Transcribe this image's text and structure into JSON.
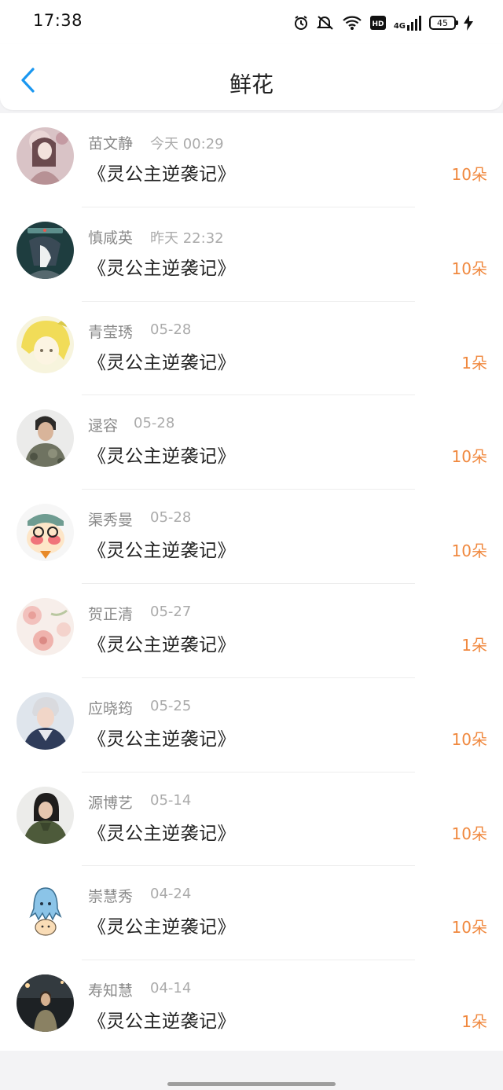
{
  "status_bar": {
    "time": "17:38",
    "network": "4G",
    "hd": "HD",
    "battery": "45"
  },
  "header": {
    "title": "鲜花"
  },
  "colors": {
    "accent": "#1a97f0",
    "count": "#f0883e",
    "name": "#8a8a8a",
    "time": "#ababab"
  },
  "entries": [
    {
      "name": "苗文静",
      "time": "今天 00:29",
      "book": "《灵公主逆袭记》",
      "count": "10朵",
      "avatar": "girl-illustration-avatar"
    },
    {
      "name": "慎咸英",
      "time": "昨天 22:32",
      "book": "《灵公主逆袭记》",
      "count": "10朵",
      "avatar": "anime-boy-avatar"
    },
    {
      "name": "青莹琇",
      "time": "05-28",
      "book": "《灵公主逆袭记》",
      "count": "1朵",
      "avatar": "yellow-anime-avatar"
    },
    {
      "name": "逯容",
      "time": "05-28",
      "book": "《灵公主逆袭记》",
      "count": "10朵",
      "avatar": "man-camo-shirt-avatar"
    },
    {
      "name": "渠秀曼",
      "time": "05-28",
      "book": "《灵公主逆袭记》",
      "count": "10朵",
      "avatar": "cartoon-detective-avatar"
    },
    {
      "name": "贺正清",
      "time": "05-27",
      "book": "《灵公主逆袭记》",
      "count": "1朵",
      "avatar": "pink-flowers-avatar"
    },
    {
      "name": "应晓筠",
      "time": "05-25",
      "book": "《灵公主逆袭记》",
      "count": "10朵",
      "avatar": "silver-hair-man-avatar"
    },
    {
      "name": "源博艺",
      "time": "05-14",
      "book": "《灵公主逆袭记》",
      "count": "10朵",
      "avatar": "woman-green-coat-avatar"
    },
    {
      "name": "崇慧秀",
      "time": "04-24",
      "book": "《灵公主逆袭记》",
      "count": "10朵",
      "avatar": "blue-octopus-avatar"
    },
    {
      "name": "寿知慧",
      "time": "04-14",
      "book": "《灵公主逆袭记》",
      "count": "1朵",
      "avatar": "night-portrait-avatar"
    }
  ]
}
